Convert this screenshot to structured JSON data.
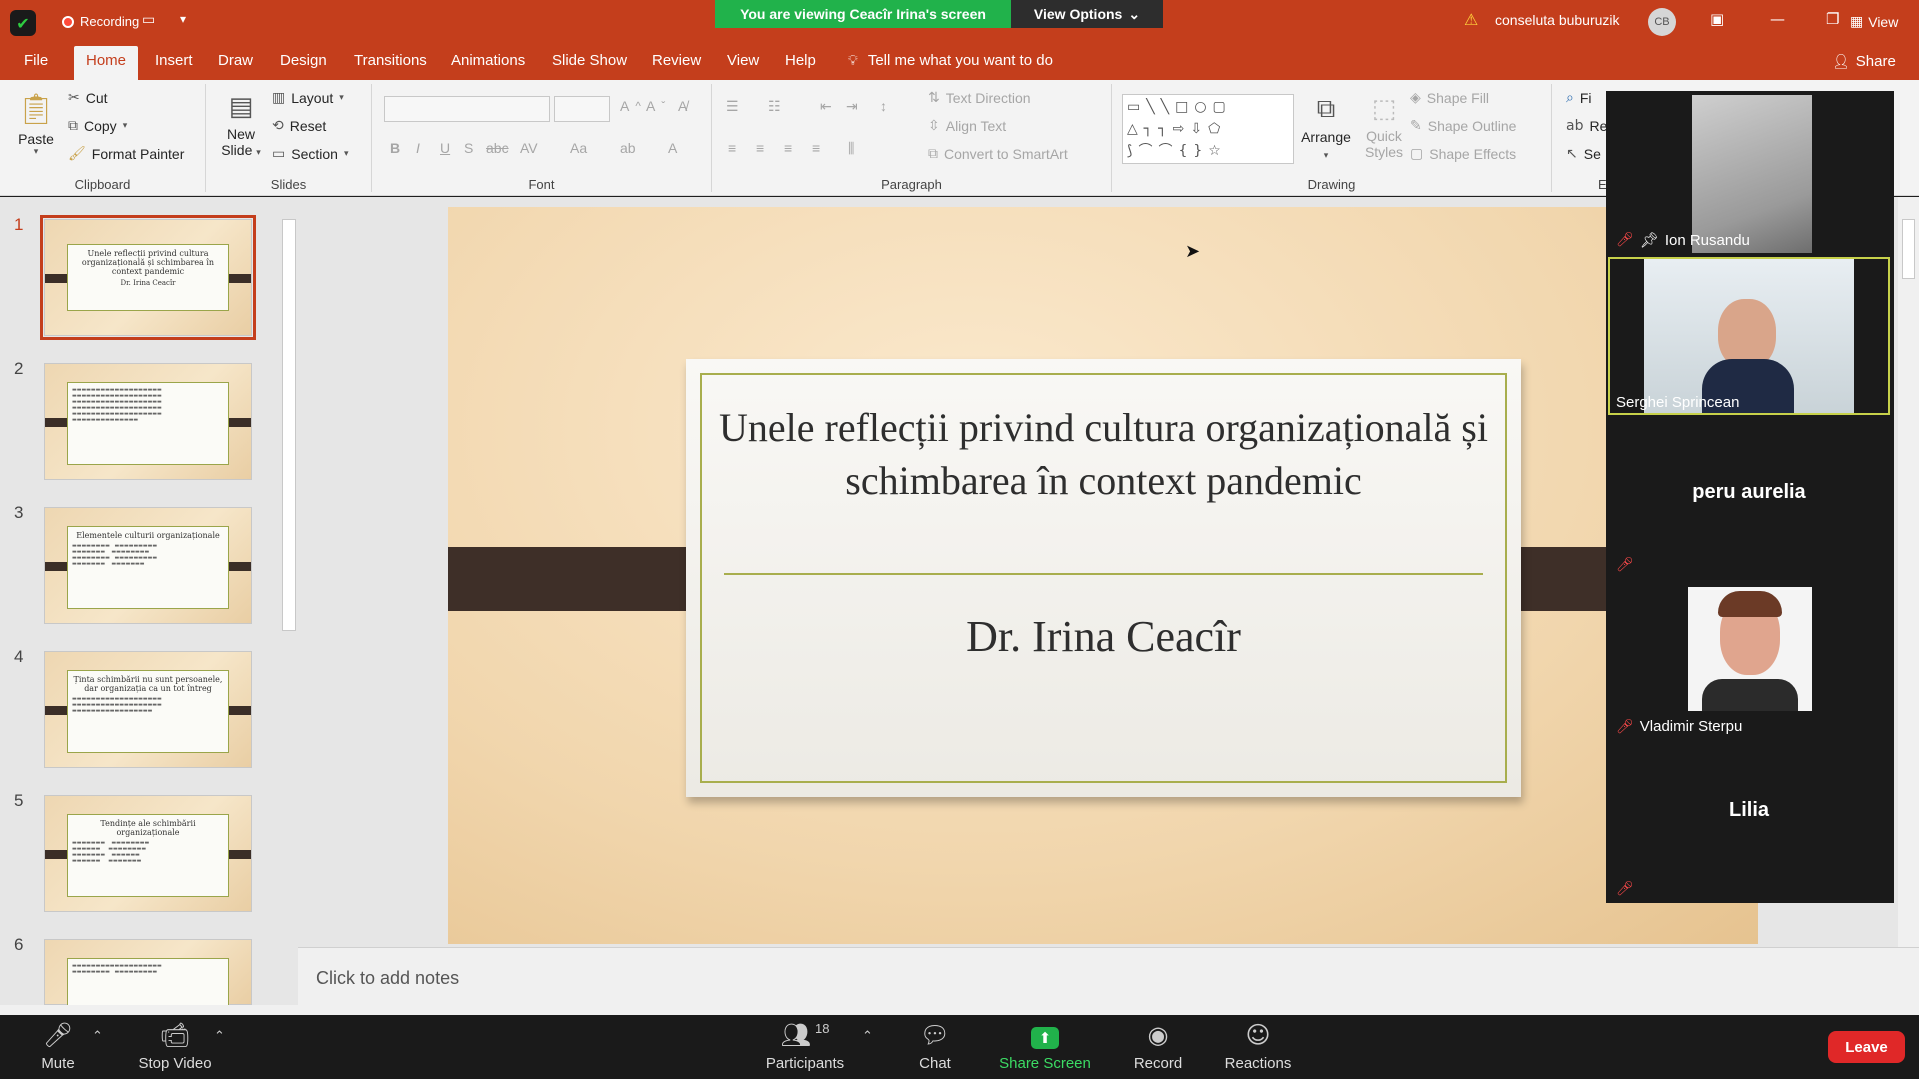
{
  "titlebar": {
    "recording_label": "Recording",
    "viewing_banner": "You are viewing Ceacîr Irina's screen",
    "view_options": "View Options",
    "username": "conseluta buburuzik",
    "avatar_initials": "CB",
    "view_label": "View"
  },
  "tabs": [
    "File",
    "Home",
    "Insert",
    "Draw",
    "Design",
    "Transitions",
    "Animations",
    "Slide Show",
    "Review",
    "View",
    "Help"
  ],
  "tell_me": "Tell me what you want to do",
  "share": "Share",
  "ribbon": {
    "clipboard": {
      "paste": "Paste",
      "cut": "Cut",
      "copy": "Copy",
      "format_painter": "Format Painter",
      "label": "Clipboard"
    },
    "slides": {
      "new_slide_1": "New",
      "new_slide_2": "Slide",
      "layout": "Layout",
      "reset": "Reset",
      "section": "Section",
      "label": "Slides"
    },
    "font": {
      "label": "Font"
    },
    "paragraph": {
      "text_direction": "Text Direction",
      "align_text": "Align Text",
      "convert_smartart": "Convert to SmartArt",
      "label": "Paragraph"
    },
    "drawing": {
      "arrange": "Arrange",
      "quick_1": "Quick",
      "quick_2": "Styles",
      "shape_fill": "Shape Fill",
      "shape_outline": "Shape Outline",
      "shape_effects": "Shape Effects",
      "label": "Drawing"
    },
    "editing": {
      "find": "Fi",
      "replace": "Re",
      "select": "Se",
      "label": "Ed"
    }
  },
  "slides_panel": {
    "numbers": [
      "1",
      "2",
      "3",
      "4",
      "5",
      "6"
    ],
    "thumb_titles": [
      "Unele reflecții privind cultura organizațională și schimbarea în context pandemic",
      "",
      "Elementele culturii organizaționale",
      "Ținta schimbării nu sunt persoanele, dar organizația ca un tot întreg",
      "Tendințe ale schimbării organizaționale",
      ""
    ],
    "thumb1_sub": "Dr. Irina Ceacîr"
  },
  "slide": {
    "title": "Unele reflecții privind cultura organizațională și schimbarea în context pandemic",
    "subtitle": "Dr. Irina Ceacîr"
  },
  "notes_placeholder": "Click to add notes",
  "participants_gallery": [
    {
      "name": "Ion Rusandu",
      "video": true
    },
    {
      "name": "Serghei Sprincean",
      "video": true
    },
    {
      "name": "peru aurelia",
      "video": false
    },
    {
      "name": "Vladimir Sterpu",
      "video": true
    },
    {
      "name": "Lilia",
      "video": false
    }
  ],
  "zoom_toolbar": {
    "mute": "Mute",
    "stop_video": "Stop Video",
    "participants": "Participants",
    "participants_count": "18",
    "chat": "Chat",
    "share_screen": "Share Screen",
    "record": "Record",
    "reactions": "Reactions",
    "leave": "Leave"
  },
  "colors": {
    "office_accent": "#c43e1c",
    "zoom_green": "#21b24b",
    "leave_red": "#e02828",
    "slide_accent": "#a8ae4d"
  }
}
